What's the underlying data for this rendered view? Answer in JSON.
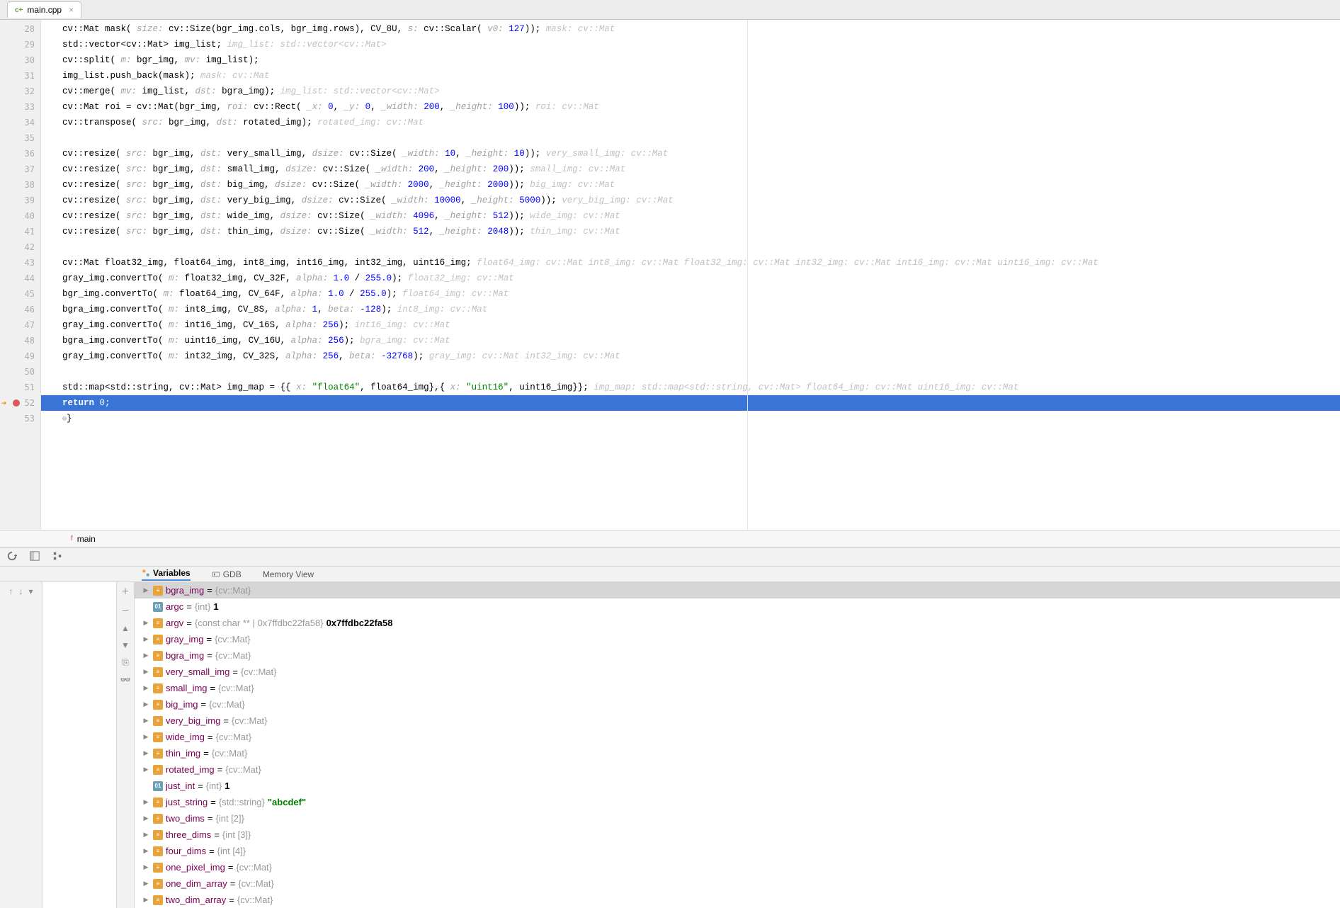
{
  "tab": {
    "filename": "main.cpp"
  },
  "gutter_start": 28,
  "highlight_line": 52,
  "breakpoint_line": 52,
  "code_lines": [
    {
      "n": 28,
      "html": "cv::Mat mask( <span class='inlay'>size:</span> cv::Size(bgr_img.cols, bgr_img.rows), CV_8U, <span class='inlay'>s:</span> cv::Scalar( <span class='inlay'>v0:</span> <span class='num'>127</span>));   <span class='hint'>mask: cv::Mat</span>"
    },
    {
      "n": 29,
      "html": "std::vector&lt;cv::Mat&gt; img_list;   <span class='hint'>img_list: std::vector&lt;cv::Mat&gt;</span>"
    },
    {
      "n": 30,
      "html": "cv::split( <span class='inlay'>m:</span> bgr_img, <span class='inlay'>mv:</span> img_list);"
    },
    {
      "n": 31,
      "html": "img_list.push_back(mask);   <span class='hint'>mask: cv::Mat</span>"
    },
    {
      "n": 32,
      "html": "cv::merge( <span class='inlay'>mv:</span> img_list, <span class='inlay'>dst:</span> bgra_img);   <span class='hint'>img_list: std::vector&lt;cv::Mat&gt;</span>"
    },
    {
      "n": 33,
      "html": "cv::Mat roi = cv::Mat(bgr_img, <span class='inlay'>roi:</span> cv::Rect( <span class='inlay'>_x:</span> <span class='num'>0</span>, <span class='inlay'>_y:</span> <span class='num'>0</span>, <span class='inlay'>_width:</span> <span class='num'>200</span>, <span class='inlay'>_height:</span> <span class='num'>100</span>));   <span class='hint'>roi: cv::Mat</span>"
    },
    {
      "n": 34,
      "html": "cv::transpose( <span class='inlay'>src:</span> bgr_img, <span class='inlay'>dst:</span> rotated_img);   <span class='hint'>rotated_img: cv::Mat</span>"
    },
    {
      "n": 35,
      "html": ""
    },
    {
      "n": 36,
      "html": "cv::resize( <span class='inlay'>src:</span> bgr_img, <span class='inlay'>dst:</span> very_small_img, <span class='inlay'>dsize:</span> cv::Size( <span class='inlay'>_width:</span> <span class='num'>10</span>, <span class='inlay'>_height:</span> <span class='num'>10</span>));   <span class='hint'>very_small_img: cv::Mat</span>"
    },
    {
      "n": 37,
      "html": "cv::resize( <span class='inlay'>src:</span> bgr_img, <span class='inlay'>dst:</span> small_img, <span class='inlay'>dsize:</span> cv::Size( <span class='inlay'>_width:</span> <span class='num'>200</span>, <span class='inlay'>_height:</span> <span class='num'>200</span>));   <span class='hint'>small_img: cv::Mat</span>"
    },
    {
      "n": 38,
      "html": "cv::resize( <span class='inlay'>src:</span> bgr_img, <span class='inlay'>dst:</span> big_img, <span class='inlay'>dsize:</span> cv::Size( <span class='inlay'>_width:</span> <span class='num'>2000</span>, <span class='inlay'>_height:</span> <span class='num'>2000</span>));   <span class='hint'>big_img: cv::Mat</span>"
    },
    {
      "n": 39,
      "html": "cv::resize( <span class='inlay'>src:</span> bgr_img, <span class='inlay'>dst:</span> very_big_img, <span class='inlay'>dsize:</span> cv::Size( <span class='inlay'>_width:</span> <span class='num'>10000</span>, <span class='inlay'>_height:</span> <span class='num'>5000</span>));   <span class='hint'>very_big_img: cv::Mat</span>"
    },
    {
      "n": 40,
      "html": "cv::resize( <span class='inlay'>src:</span> bgr_img, <span class='inlay'>dst:</span> wide_img, <span class='inlay'>dsize:</span> cv::Size( <span class='inlay'>_width:</span> <span class='num'>4096</span>, <span class='inlay'>_height:</span> <span class='num'>512</span>));   <span class='hint'>wide_img: cv::Mat</span>"
    },
    {
      "n": 41,
      "html": "cv::resize( <span class='inlay'>src:</span> bgr_img, <span class='inlay'>dst:</span> thin_img, <span class='inlay'>dsize:</span> cv::Size( <span class='inlay'>_width:</span> <span class='num'>512</span>, <span class='inlay'>_height:</span> <span class='num'>2048</span>));   <span class='hint'>thin_img: cv::Mat</span>"
    },
    {
      "n": 42,
      "html": ""
    },
    {
      "n": 43,
      "html": "cv::Mat float32_img, float64_img, int8_img, int16_img, int32_img, uint16_img;   <span class='hint'>float64_img: cv::Mat    int8_img: cv::Mat    float32_img: cv::Mat    int32_img: cv::Mat    int16_img: cv::Mat    uint16_img: cv::Mat</span>"
    },
    {
      "n": 44,
      "html": "gray_img.convertTo( <span class='inlay'>m:</span> float32_img, CV_32F, <span class='inlay'>alpha:</span> <span class='num'>1.0</span> / <span class='num'>255.0</span>);   <span class='hint'>float32_img: cv::Mat</span>"
    },
    {
      "n": 45,
      "html": "bgr_img.convertTo( <span class='inlay'>m:</span> float64_img, CV_64F, <span class='inlay'>alpha:</span> <span class='num'>1.0</span> / <span class='num'>255.0</span>);   <span class='hint'>float64_img: cv::Mat</span>"
    },
    {
      "n": 46,
      "html": "bgra_img.convertTo( <span class='inlay'>m:</span> int8_img, CV_8S, <span class='inlay'>alpha:</span> <span class='num'>1</span>, <span class='inlay'>beta:</span> <span class='num'>-128</span>);   <span class='hint'>int8_img: cv::Mat</span>"
    },
    {
      "n": 47,
      "html": "gray_img.convertTo( <span class='inlay'>m:</span> int16_img, CV_16S, <span class='inlay'>alpha:</span> <span class='num'>256</span>);   <span class='hint'>int16_img: cv::Mat</span>"
    },
    {
      "n": 48,
      "html": "bgra_img.convertTo( <span class='inlay'>m:</span> uint16_img, CV_16U, <span class='inlay'>alpha:</span> <span class='num'>256</span>);   <span class='hint'>bgra_img: cv::Mat</span>"
    },
    {
      "n": 49,
      "html": "gray_img.convertTo( <span class='inlay'>m:</span> int32_img, CV_32S, <span class='inlay'>alpha:</span> <span class='num'>256</span>, <span class='inlay'>beta:</span> <span class='num'>-32768</span>);   <span class='hint'>gray_img: cv::Mat    int32_img: cv::Mat</span>"
    },
    {
      "n": 50,
      "html": ""
    },
    {
      "n": 51,
      "html": "std::map&lt;std::string, cv::Mat&gt; img_map = {{ <span class='inlay'>x:</span> <span style='color:#008000'>\"float64\"</span>, float64_img},{ <span class='inlay'>x:</span> <span style='color:#008000'>\"uint16\"</span>, uint16_img}};   <span class='hint'>img_map: std::map&lt;std::string, cv::Mat&gt;    float64_img: cv::Mat    uint16_img: cv::Mat</span>"
    },
    {
      "n": 52,
      "html": "<span class='kw'>return</span> <span class='num'>0</span>;",
      "cur": true
    },
    {
      "n": 53,
      "html": "<span class='fold'>⊖</span>}"
    }
  ],
  "breadcrumb": {
    "fn": "main"
  },
  "debug_tabs": [
    "Variables",
    "GDB",
    "Memory View"
  ],
  "variables": [
    {
      "exp": true,
      "ic": "obj",
      "name": "bgra_img",
      "type": "{cv::Mat}",
      "sel": true
    },
    {
      "exp": false,
      "noarrow": true,
      "ic": "prim",
      "name": "argc",
      "type": "{int}",
      "val": "1"
    },
    {
      "exp": true,
      "ic": "obj",
      "name": "argv",
      "type": "{const char ** | 0x7ffdbc22fa58}",
      "val": "0x7ffdbc22fa58"
    },
    {
      "exp": true,
      "ic": "obj",
      "name": "gray_img",
      "type": "{cv::Mat}"
    },
    {
      "exp": true,
      "ic": "obj",
      "name": "bgra_img",
      "type": "{cv::Mat}"
    },
    {
      "exp": true,
      "ic": "obj",
      "name": "very_small_img",
      "type": "{cv::Mat}"
    },
    {
      "exp": true,
      "ic": "obj",
      "name": "small_img",
      "type": "{cv::Mat}"
    },
    {
      "exp": true,
      "ic": "obj",
      "name": "big_img",
      "type": "{cv::Mat}"
    },
    {
      "exp": true,
      "ic": "obj",
      "name": "very_big_img",
      "type": "{cv::Mat}"
    },
    {
      "exp": true,
      "ic": "obj",
      "name": "wide_img",
      "type": "{cv::Mat}"
    },
    {
      "exp": true,
      "ic": "obj",
      "name": "thin_img",
      "type": "{cv::Mat}"
    },
    {
      "exp": true,
      "ic": "obj",
      "name": "rotated_img",
      "type": "{cv::Mat}"
    },
    {
      "exp": false,
      "noarrow": true,
      "ic": "prim",
      "name": "just_int",
      "type": "{int}",
      "val": "1"
    },
    {
      "exp": true,
      "ic": "obj",
      "name": "just_string",
      "type": "{std::string}",
      "str": "\"abcdef\""
    },
    {
      "exp": true,
      "ic": "obj",
      "name": "two_dims",
      "type": "{int [2]}"
    },
    {
      "exp": true,
      "ic": "obj",
      "name": "three_dims",
      "type": "{int [3]}"
    },
    {
      "exp": true,
      "ic": "obj",
      "name": "four_dims",
      "type": "{int [4]}"
    },
    {
      "exp": true,
      "ic": "obj",
      "name": "one_pixel_img",
      "type": "{cv::Mat}"
    },
    {
      "exp": true,
      "ic": "obj",
      "name": "one_dim_array",
      "type": "{cv::Mat}"
    },
    {
      "exp": true,
      "ic": "obj",
      "name": "two_dim_array",
      "type": "{cv::Mat}"
    }
  ]
}
